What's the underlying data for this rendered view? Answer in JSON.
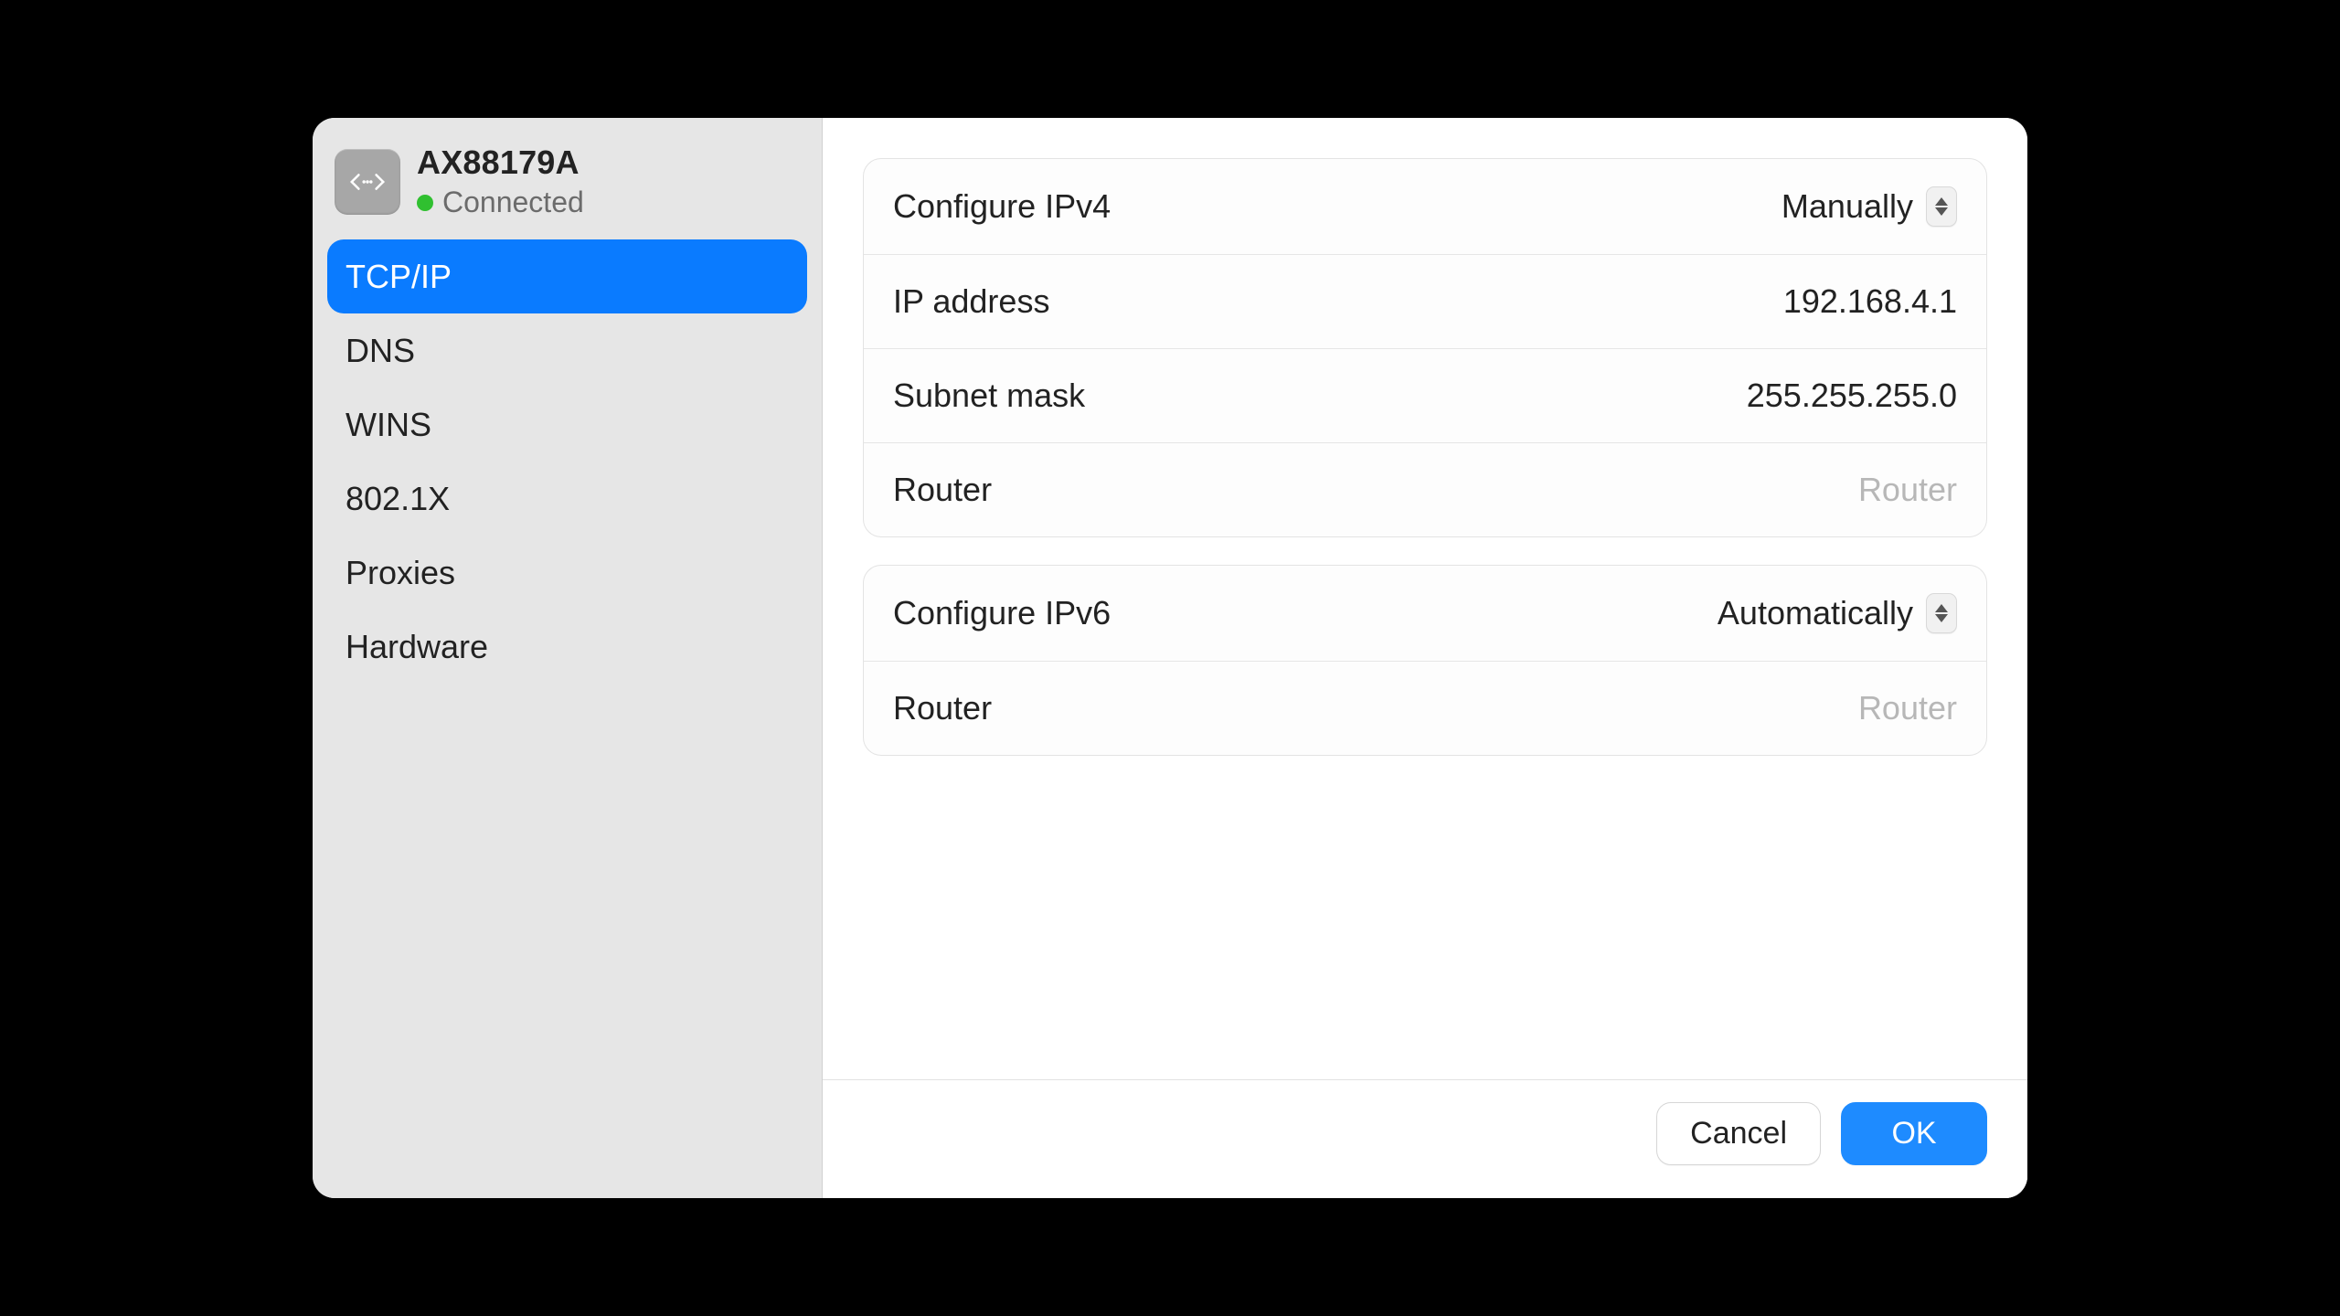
{
  "device": {
    "name": "AX88179A",
    "status": "Connected",
    "status_color": "#30c030"
  },
  "sidebar": {
    "items": [
      {
        "label": "TCP/IP",
        "active": true
      },
      {
        "label": "DNS",
        "active": false
      },
      {
        "label": "WINS",
        "active": false
      },
      {
        "label": "802.1X",
        "active": false
      },
      {
        "label": "Proxies",
        "active": false
      },
      {
        "label": "Hardware",
        "active": false
      }
    ]
  },
  "ipv4": {
    "configure_label": "Configure IPv4",
    "configure_value": "Manually",
    "ip_label": "IP address",
    "ip_value": "192.168.4.1",
    "mask_label": "Subnet mask",
    "mask_value": "255.255.255.0",
    "router_label": "Router",
    "router_placeholder": "Router"
  },
  "ipv6": {
    "configure_label": "Configure IPv6",
    "configure_value": "Automatically",
    "router_label": "Router",
    "router_placeholder": "Router"
  },
  "footer": {
    "cancel": "Cancel",
    "ok": "OK"
  }
}
